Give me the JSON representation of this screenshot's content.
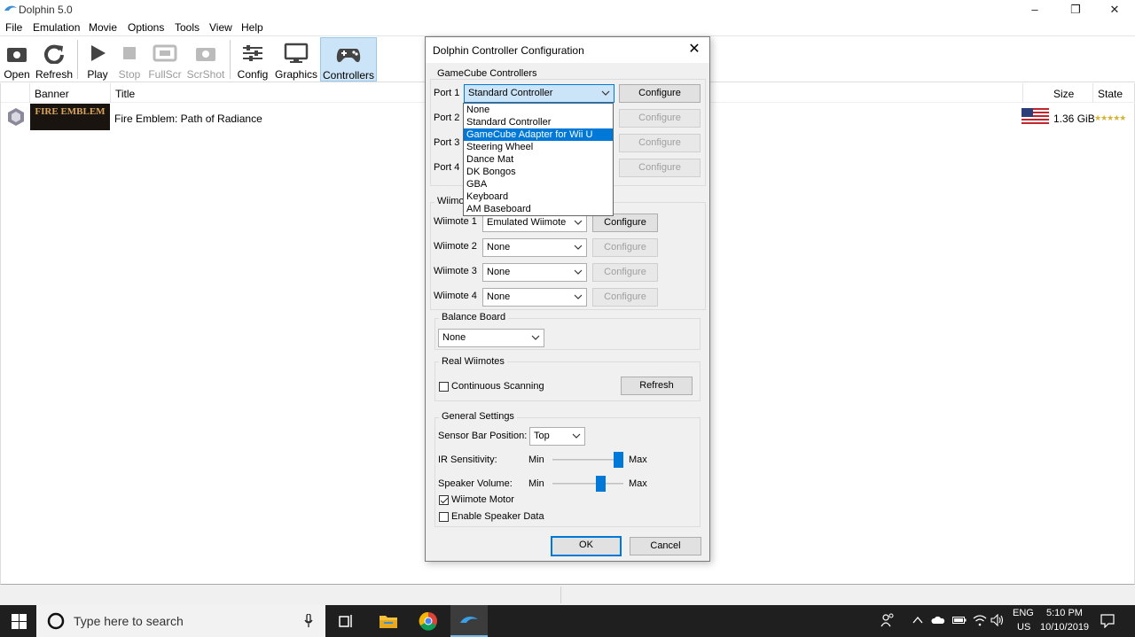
{
  "window": {
    "title": "Dolphin 5.0"
  },
  "menu": [
    "File",
    "Emulation",
    "Movie",
    "Options",
    "Tools",
    "View",
    "Help"
  ],
  "toolbar": [
    {
      "label": "Open",
      "icon": "folder-icon",
      "enabled": true
    },
    {
      "label": "Refresh",
      "icon": "refresh-icon",
      "enabled": true
    },
    {
      "label": "Play",
      "icon": "play-icon",
      "enabled": true
    },
    {
      "label": "Stop",
      "icon": "stop-icon",
      "enabled": false
    },
    {
      "label": "FullScr",
      "icon": "fullscreen-icon",
      "enabled": false
    },
    {
      "label": "ScrShot",
      "icon": "camera-icon",
      "enabled": false
    },
    {
      "label": "Config",
      "icon": "config-icon",
      "enabled": true
    },
    {
      "label": "Graphics",
      "icon": "monitor-icon",
      "enabled": true
    },
    {
      "label": "Controllers",
      "icon": "gamepad-icon",
      "enabled": true,
      "active": true
    }
  ],
  "gamelist": {
    "columns": {
      "banner": "Banner",
      "title": "Title",
      "size": "Size",
      "state": "State"
    },
    "rows": [
      {
        "banner_text": "FIRE EMBLEM",
        "title": "Fire Emblem: Path of Radiance",
        "size": "1.36 GiB",
        "stars": "★★★★★"
      }
    ]
  },
  "dialog": {
    "title": "Dolphin Controller Configuration",
    "gamecube": {
      "label": "GameCube Controllers",
      "ports": [
        {
          "label": "Port 1",
          "value": "Standard Controller",
          "button": "Configure",
          "enabled": true
        },
        {
          "label": "Port 2",
          "value": "",
          "button": "Configure",
          "enabled": false
        },
        {
          "label": "Port 3",
          "value": "",
          "button": "Configure",
          "enabled": false
        },
        {
          "label": "Port 4",
          "value": "",
          "button": "Configure",
          "enabled": false
        }
      ],
      "dropdown_options": [
        "None",
        "Standard Controller",
        "GameCube Adapter for Wii U",
        "Steering Wheel",
        "Dance Mat",
        "DK Bongos",
        "GBA",
        "Keyboard",
        "AM Baseboard"
      ],
      "dropdown_highlighted": "GameCube Adapter for Wii U"
    },
    "wiimotes": {
      "label": "Wiimo",
      "items": [
        {
          "label": "Wiimote 1",
          "value": "Emulated Wiimote",
          "button": "Configure",
          "enabled": true
        },
        {
          "label": "Wiimote 2",
          "value": "None",
          "button": "Configure",
          "enabled": false
        },
        {
          "label": "Wiimote 3",
          "value": "None",
          "button": "Configure",
          "enabled": false
        },
        {
          "label": "Wiimote 4",
          "value": "None",
          "button": "Configure",
          "enabled": false
        }
      ]
    },
    "balance_board": {
      "label": "Balance Board",
      "value": "None"
    },
    "real_wiimotes": {
      "label": "Real Wiimotes",
      "continuous_scanning": "Continuous Scanning",
      "continuous_checked": false,
      "refresh": "Refresh"
    },
    "general": {
      "label": "General Settings",
      "sensor_bar_label": "Sensor Bar Position:",
      "sensor_bar_value": "Top",
      "ir_label": "IR Sensitivity:",
      "ir_level": 0.92,
      "speaker_label": "Speaker Volume:",
      "speaker_level": 0.68,
      "min": "Min",
      "max": "Max",
      "motor_label": "Wiimote Motor",
      "motor_checked": true,
      "speaker_data_label": "Enable Speaker Data",
      "speaker_data_checked": false
    },
    "ok": "OK",
    "cancel": "Cancel"
  },
  "taskbar": {
    "search_placeholder": "Type here to search",
    "lang_top": "ENG",
    "lang_bottom": "US",
    "time": "5:10 PM",
    "date": "10/10/2019"
  },
  "colors": {
    "accent": "#0078d7",
    "highlight": "#cce4f7",
    "taskbar": "#1f1f1f"
  }
}
